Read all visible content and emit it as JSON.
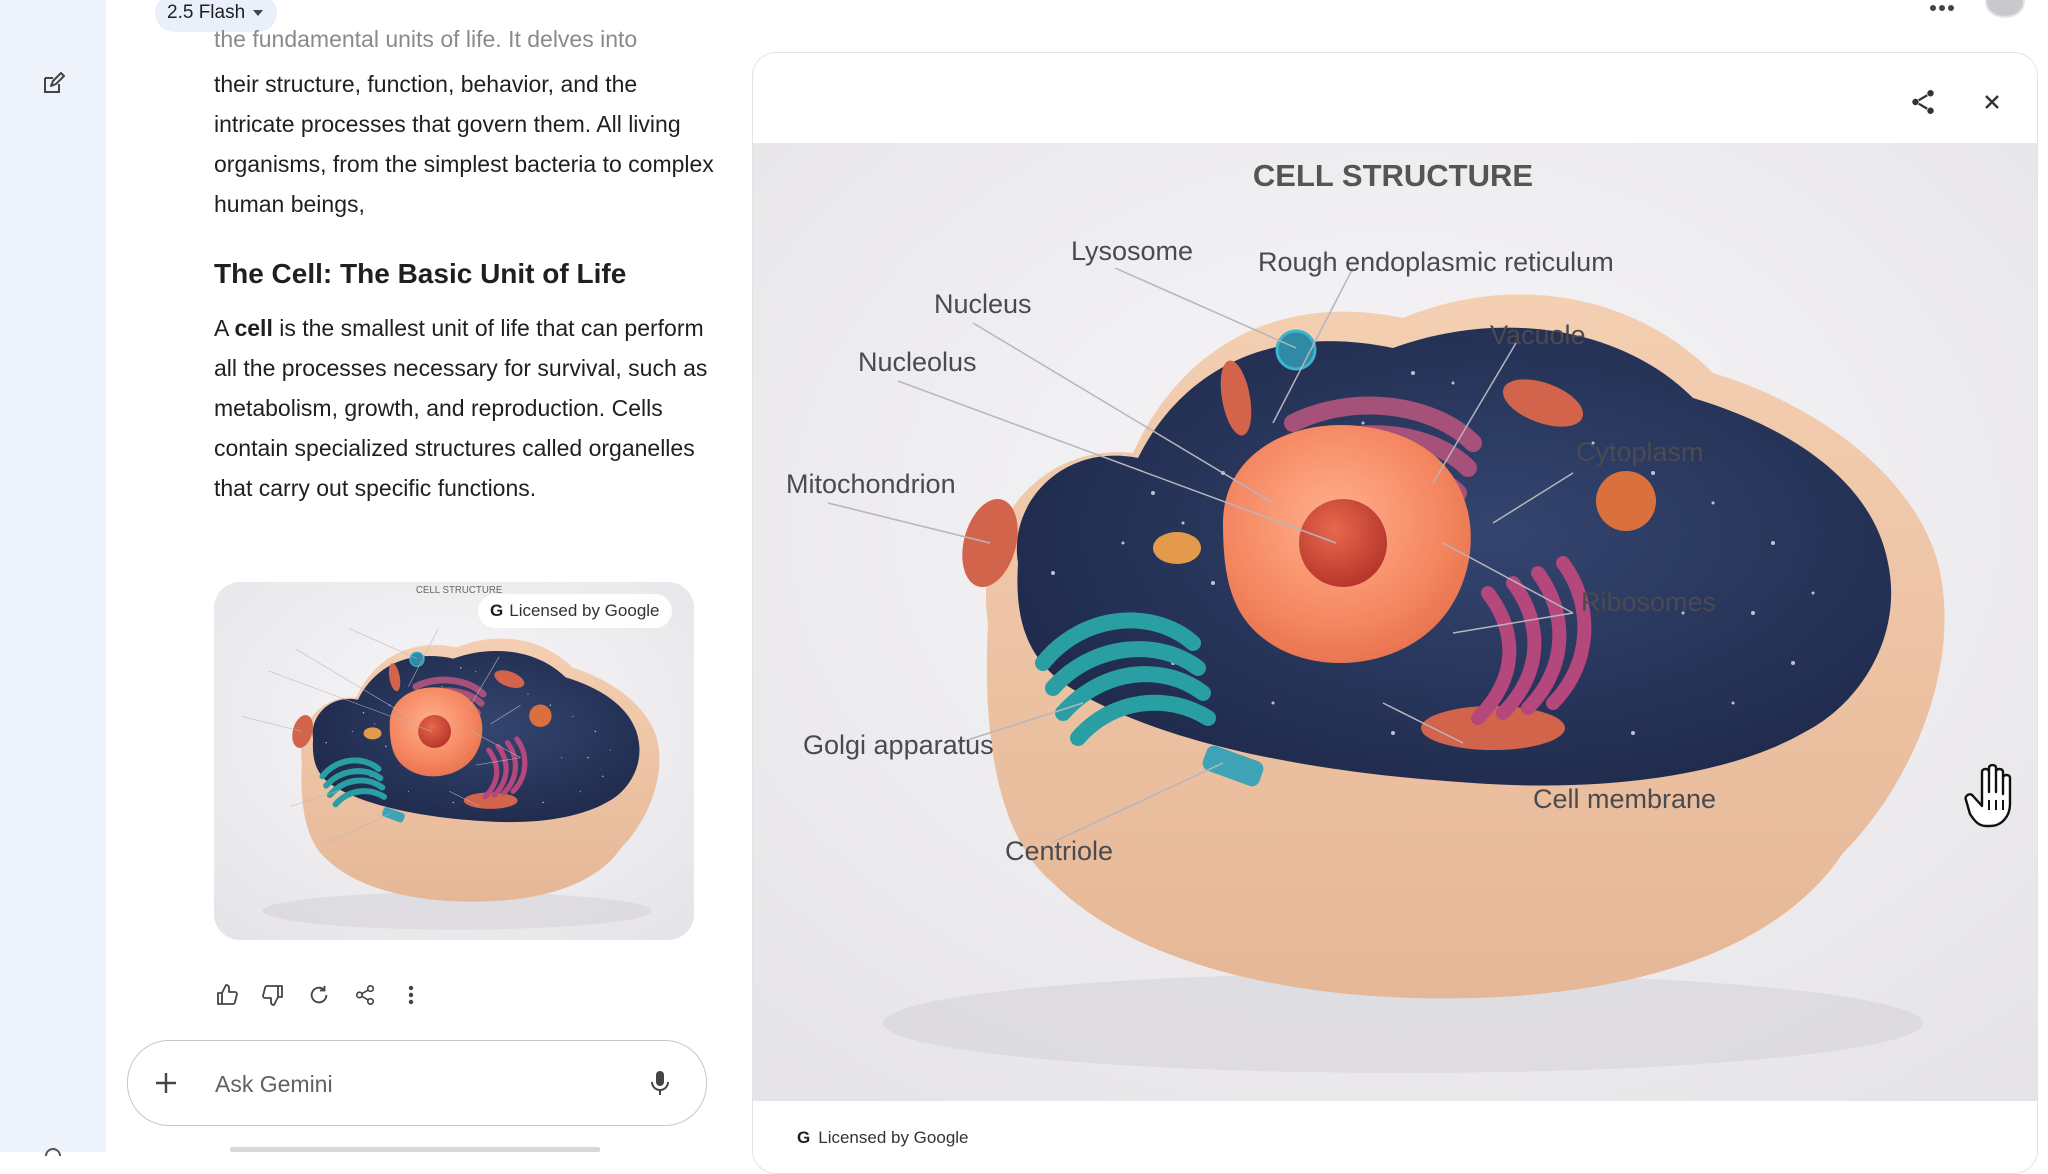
{
  "header": {
    "model_label": "2.5 Flash"
  },
  "response": {
    "faded_line": "the fundamental units of life. It delves into",
    "intro": "their structure, function, behavior, and the intricate processes that govern them. All living organisms, from the simplest bacteria to complex human beings,",
    "heading": "The Cell: The Basic Unit of Life",
    "body_bold": "cell",
    "body_prefix": "A ",
    "body_rest": " is the smallest unit of life that can perform all the processes necessary for survival, such as metabolism, growth, and reproduction. Cells contain specialized structures called organelles that carry out specific functions."
  },
  "image": {
    "title": "CELL STRUCTURE",
    "license_badge": "Licensed by Google",
    "labels": {
      "lysosome": "Lysosome",
      "rough_er": "Rough endoplasmic reticulum",
      "nucleus": "Nucleus",
      "vacuole": "Vacuole",
      "nucleolus": "Nucleolus",
      "cytoplasm": "Cytoplasm",
      "mitochondrion": "Mitochondrion",
      "ribosomes": "Ribosomes",
      "golgi": "Golgi apparatus",
      "cell_membrane": "Cell membrane",
      "centriole": "Centriole"
    }
  },
  "viewer": {
    "footer_license": "Licensed by Google"
  },
  "input": {
    "placeholder": "Ask Gemini"
  },
  "icons": {
    "new_chat": "edit-icon",
    "thumbs_up": "thumbs-up-icon",
    "thumbs_down": "thumbs-down-icon",
    "regenerate": "refresh-icon",
    "share": "share-icon",
    "more": "more-vert-icon",
    "plus": "plus-icon",
    "mic": "mic-icon",
    "close": "close-icon",
    "google": "google-g-icon"
  },
  "colors": {
    "sidebar_bg": "#eef2fb",
    "pill_bg": "#eaf0fb",
    "text": "#1f1f1f"
  }
}
